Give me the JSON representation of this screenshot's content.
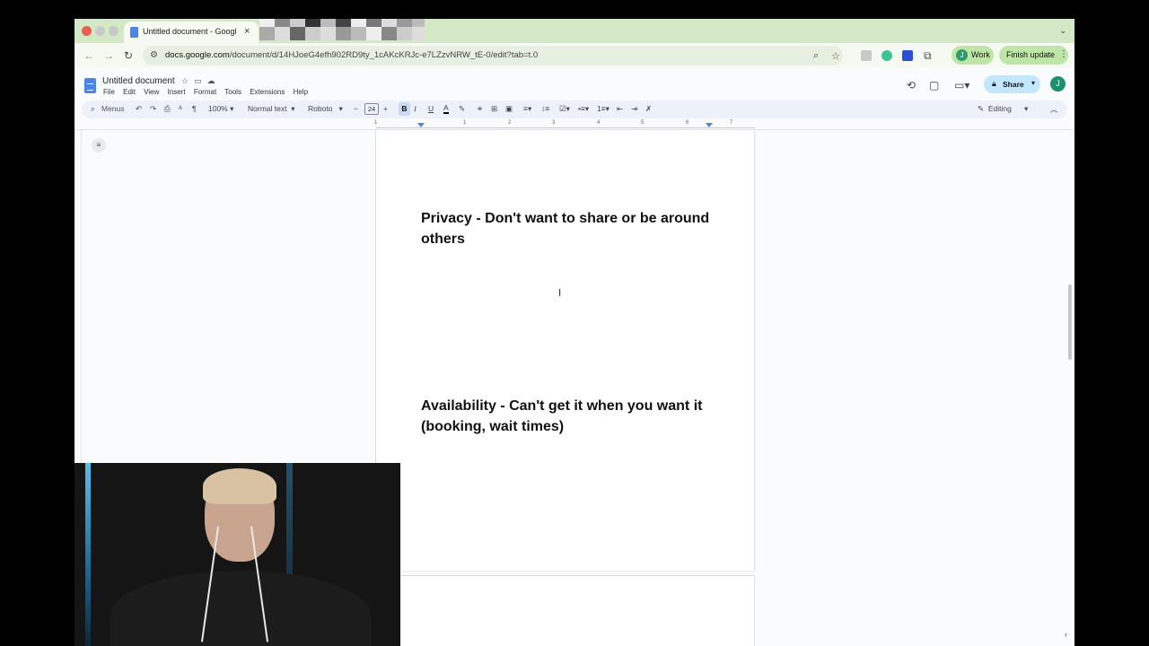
{
  "browser": {
    "tab_title": "Untitled document - Google D",
    "tab_close": "×",
    "url_domain": "docs.google.com",
    "url_path": "/document/d/14HJoeG4efh902RD9ty_1cAKcKRJc-e7LZzvNRW_tE-0/edit?tab=t.0",
    "profile_initial": "J",
    "profile_label": "Work",
    "update_label": "Finish update"
  },
  "docs": {
    "title": "Untitled document",
    "menu": [
      "File",
      "Edit",
      "View",
      "Insert",
      "Format",
      "Tools",
      "Extensions",
      "Help"
    ],
    "share_label": "Share",
    "avatar_initial": "J",
    "toolbar": {
      "search_label": "Menus",
      "zoom": "100%",
      "style": "Normal text",
      "font": "Roboto",
      "font_size": "24",
      "bold": "B",
      "italic": "I",
      "underline": "U",
      "text_color": "A",
      "mode": "Editing"
    },
    "ruler": [
      "1",
      "1",
      "2",
      "3",
      "4",
      "5",
      "6",
      "7"
    ]
  },
  "document": {
    "headings": [
      "Privacy - Don't want to share or be around others",
      "Availability - Can't get it when you want it (booking, wait times)"
    ]
  },
  "colors": {
    "tabstrip": "#d3e8c4",
    "accent_blue": "#4a86e8",
    "share_bg": "#c2e7ff",
    "profile_green": "#bfe6a8"
  }
}
